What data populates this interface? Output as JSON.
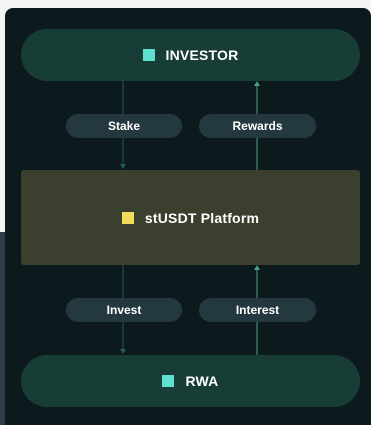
{
  "nodes": {
    "investor": {
      "label": "INVESTOR",
      "color": "#5ee0d0"
    },
    "platform": {
      "label": "stUSDT Platform",
      "color": "#f3dc5b"
    },
    "rwa": {
      "label": "RWA",
      "color": "#5ee0d0"
    }
  },
  "edges": {
    "stake": "Stake",
    "rewards": "Rewards",
    "invest": "Invest",
    "interest": "Interest"
  },
  "colors": {
    "down_arrow": "#1f5b58",
    "up_arrow": "#3ea57a"
  }
}
